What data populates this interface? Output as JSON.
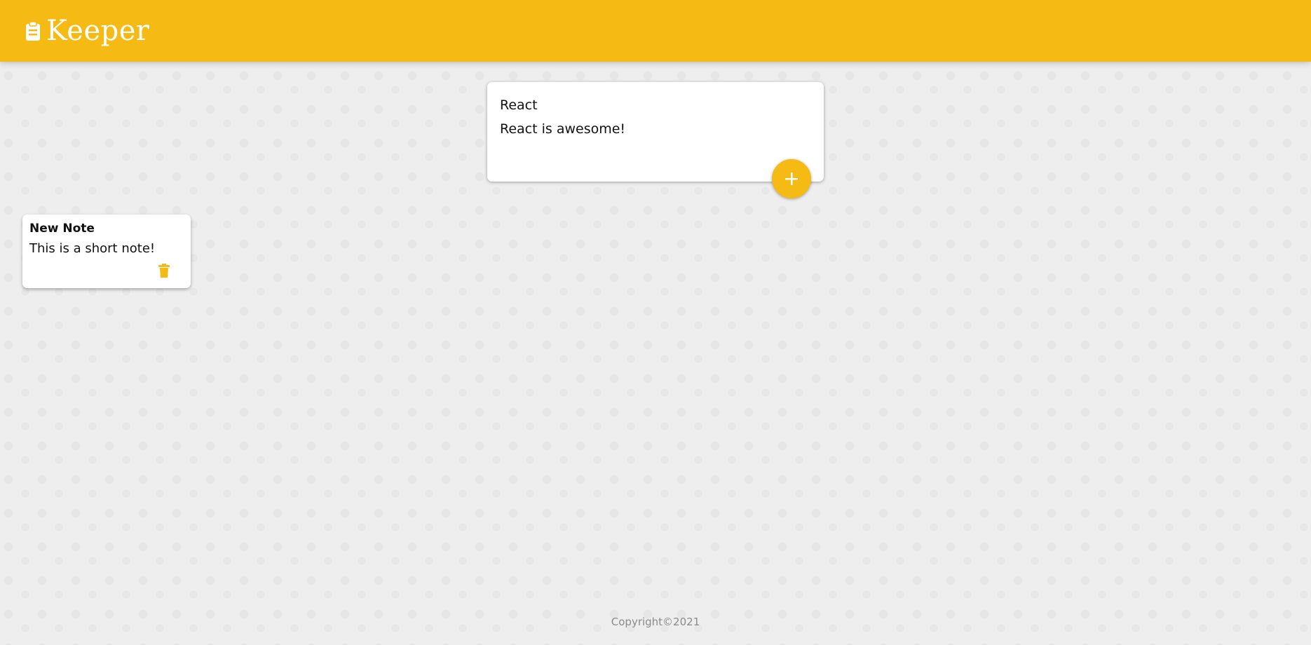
{
  "header": {
    "app_name": "Keeper",
    "brand_icon": "clipboard-icon",
    "bg_color": "#f5ba13"
  },
  "create_note": {
    "title_value": "React",
    "content_value": "React is awesome!",
    "add_icon": "plus-icon"
  },
  "notes": [
    {
      "title": "New Note",
      "content": "This is a short note!",
      "delete_icon": "trash-icon"
    }
  ],
  "footer": {
    "text": "Copyright©2021"
  },
  "colors": {
    "accent": "#f5ba13",
    "background": "#eeeeee",
    "card": "#ffffff"
  }
}
